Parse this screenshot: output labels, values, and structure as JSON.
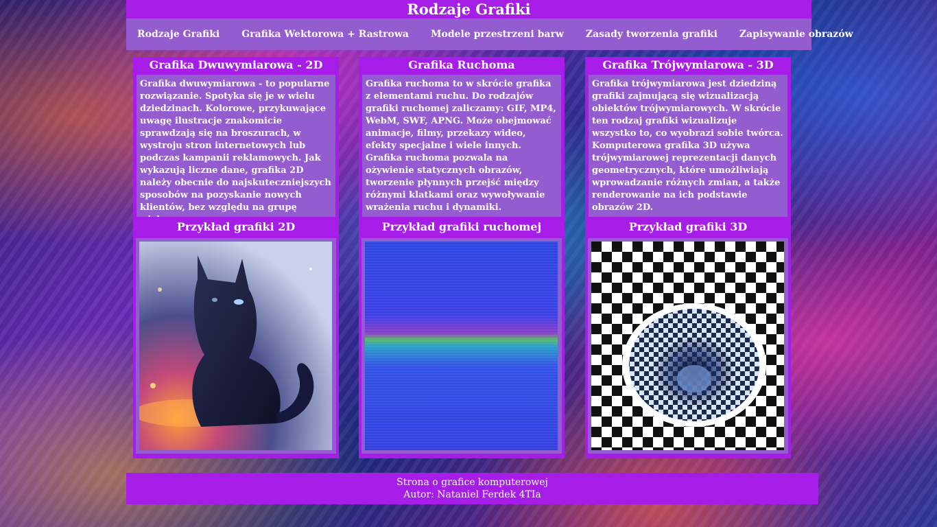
{
  "header": {
    "title": "Rodzaje Grafiki"
  },
  "nav": {
    "items": [
      "Rodzaje Grafiki",
      "Grafika Wektorowa + Rastrowa",
      "Modele przestrzeni barw",
      "Zasady tworzenia grafiki",
      "Zapisywanie obrazów"
    ]
  },
  "columns": [
    {
      "title": "Grafika Dwuwymiarowa - 2D",
      "text": "Grafika dwuwymiarowa - to popularne rozwiązanie. Spotyka się je w wielu dziedzinach. Kolorowe, przykuwające uwagę ilustracje znakomicie sprawdzają się na broszurach, w wystroju stron internetowych lub podczas kampanii reklamowych. Jak wykazują liczne dane, grafika 2D należy obecnie do najskuteczniejszych sposobów na pozyskanie nowych klientów, bez względu na grupę wiekową.",
      "example_title": "Przykład grafiki 2D"
    },
    {
      "title": "Grafika Ruchoma",
      "text": "Grafika ruchoma to w skrócie grafika z elementami ruchu. Do rodzajów grafiki ruchomej zaliczamy: GIF, MP4, WebM, SWF, APNG. Może obejmować animacje, filmy, przekazy wideo, efekty specjalne i wiele innych. Grafika ruchoma pozwala na ożywienie statycznych obrazów, tworzenie płynnych przejść między różnymi klatkami oraz wywoływanie wrażenia ruchu i dynamiki.",
      "example_title": "Przykład grafiki ruchomej"
    },
    {
      "title": "Grafika Trójwymiarowa - 3D",
      "text": "Grafika trójwymiarowa jest dziedziną grafiki zajmującą się wizualizacją obiektów trójwymiarowych. W skrócie ten rodzaj grafiki wizualizuje wszystko to, co wyobrazi sobie twórca. Komputerowa grafika 3D używa trójwymiarowej reprezentacji danych geometrycznych, które umożliwiają wprowadzanie różnych zmian, a także renderowanie na ich podstawie obrazów 2D.",
      "example_title": "Przykład grafiki 3D"
    }
  ],
  "footer": {
    "line1": "Strona o grafice komputerowej",
    "line2": "Autor: Nataniel Ferdek 4TIa"
  },
  "colors": {
    "header_bg": "#a51de6",
    "nav_bg": "#935dcf",
    "text": "#ffffff"
  }
}
